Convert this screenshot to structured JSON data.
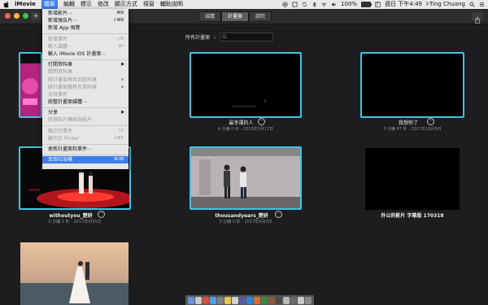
{
  "menubar": {
    "app_name": "iMovie",
    "items": [
      "檔案",
      "編輯",
      "標示",
      "修改",
      "顯示方式",
      "視窗",
      "輔助說明"
    ],
    "active_index": 0,
    "battery": "100%",
    "clock": "週日 下午4:49",
    "user": "I-Ting Chuang"
  },
  "toolbar": {
    "segments": [
      "媒體",
      "計畫案",
      "劇院"
    ],
    "selected_segment": 1
  },
  "filter": {
    "label": "所有計畫案",
    "search_value": ""
  },
  "file_menu": {
    "items": [
      {
        "label": "新增影片⋯",
        "shortcut": "⌘N",
        "enabled": true
      },
      {
        "label": "新增預告片⋯",
        "shortcut": "⇧⌘N",
        "enabled": true
      },
      {
        "label": "新增 App 預覽",
        "shortcut": "",
        "enabled": true
      },
      {
        "sep": true
      },
      {
        "label": "新增事件",
        "shortcut": "⌥N",
        "enabled": false
      },
      {
        "label": "輸入媒體⋯",
        "shortcut": "⌘I",
        "enabled": false
      },
      {
        "label": "輸入 iMovie iOS 計畫案⋯",
        "shortcut": "",
        "enabled": true
      },
      {
        "sep": true
      },
      {
        "label": "打開資料庫",
        "submenu": true,
        "enabled": true
      },
      {
        "label": "關閉資料庫",
        "enabled": false
      },
      {
        "label": "將計畫案拷貝到資料庫",
        "submenu": true,
        "enabled": false
      },
      {
        "label": "將計畫案搬移至資料庫",
        "submenu": true,
        "enabled": false
      },
      {
        "label": "合併事件",
        "enabled": false
      },
      {
        "label": "統整計畫案媒體⋯",
        "enabled": true
      },
      {
        "sep": true
      },
      {
        "label": "分享",
        "submenu": true,
        "enabled": true
      },
      {
        "label": "將預告片轉換為影片",
        "enabled": false
      },
      {
        "sep": true
      },
      {
        "label": "顯示於事件",
        "shortcut": "⇧F",
        "enabled": false
      },
      {
        "label": "顯示於 Finder",
        "shortcut": "⇧⌘R",
        "enabled": false
      },
      {
        "sep": true
      },
      {
        "label": "更新計畫案和事件⋯",
        "enabled": true
      },
      {
        "sep": true
      },
      {
        "label": "丟到垃圾桶",
        "shortcut": "⌘⌫",
        "enabled": true,
        "highlighted": true
      }
    ]
  },
  "projects": [
    {
      "title": "",
      "meta": ""
    },
    {
      "title": "最幸運的人",
      "meta": "4 分鐘 0 秒 - 2018年3月17日"
    },
    {
      "title": "我想你了",
      "meta": "3 分鐘 47 秒 - 2017年10月9日"
    },
    {
      "title": "withoutyou_楚妍",
      "meta": "3 分鐘 2 秒 - 2017年9月5日"
    },
    {
      "title": "thousandyears_楚妍",
      "meta": "3 分鐘 0 秒 - 2017年9月3日"
    },
    {
      "title": "外公的影片 字幕版 170318",
      "meta": ""
    },
    {
      "title": "",
      "meta": ""
    }
  ],
  "colors": {
    "selection": "#3fc4e4",
    "menu_highlight": "#3b7de9",
    "background": "#1d1d1f"
  }
}
